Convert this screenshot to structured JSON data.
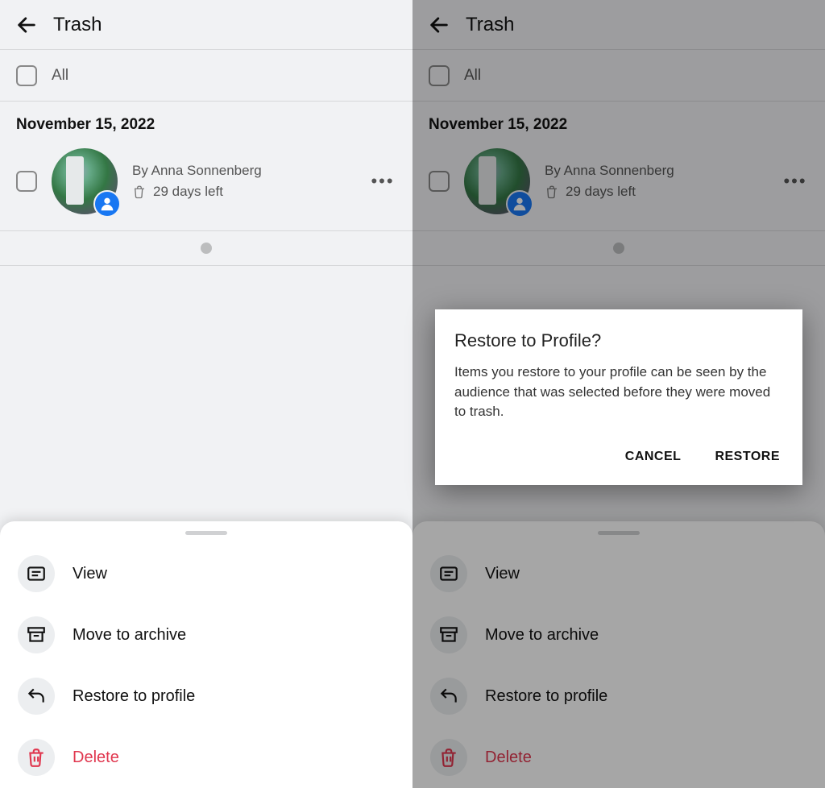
{
  "header": {
    "title": "Trash"
  },
  "all_label": "All",
  "date_heading": "November 15, 2022",
  "item": {
    "byline": "By Anna Sonnenberg",
    "days_left": "29 days left"
  },
  "sheet": {
    "view": "View",
    "archive": "Move to archive",
    "restore": "Restore to profile",
    "delete": "Delete"
  },
  "dialog": {
    "title": "Restore to Profile?",
    "body": "Items you restore to your profile can be seen by the audience that was selected before they were moved to trash.",
    "cancel": "CANCEL",
    "restore": "RESTORE"
  }
}
